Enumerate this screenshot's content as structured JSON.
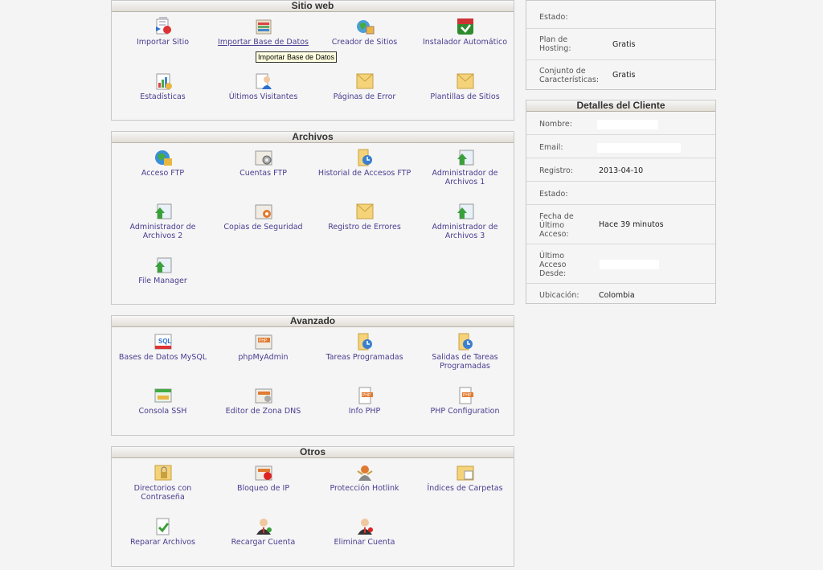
{
  "sitio_web": {
    "title": "Sitio web",
    "items": [
      {
        "label": "Importar Sitio",
        "icon": "import-site-icon"
      },
      {
        "label": "Importar Base de Datos",
        "icon": "import-database-icon"
      },
      {
        "label": "Creador de Sitios",
        "icon": "site-builder-icon"
      },
      {
        "label": "Instalador Automático",
        "icon": "auto-installer-icon"
      },
      {
        "label": "Estadísticas",
        "icon": "statistics-icon"
      },
      {
        "label": "Últimos Visitantes",
        "icon": "visitors-icon"
      },
      {
        "label": "Páginas de Error",
        "icon": "error-pages-icon"
      },
      {
        "label": "Plantillas de Sitios",
        "icon": "templates-icon"
      }
    ],
    "tooltip": "Importar Base de Datos"
  },
  "archivos": {
    "title": "Archivos",
    "items": [
      {
        "label": "Acceso FTP",
        "icon": "ftp-access-icon"
      },
      {
        "label": "Cuentas FTP",
        "icon": "ftp-accounts-icon"
      },
      {
        "label": "Historial de Accesos FTP",
        "icon": "ftp-history-icon"
      },
      {
        "label": "Administrador de Archivos 1",
        "icon": "file-manager-icon"
      },
      {
        "label": "Administrador de Archivos 2",
        "icon": "file-manager-icon"
      },
      {
        "label": "Copias de Seguridad",
        "icon": "backup-icon"
      },
      {
        "label": "Registro de Errores",
        "icon": "error-log-icon"
      },
      {
        "label": "Administrador de Archivos 3",
        "icon": "file-manager-icon"
      },
      {
        "label": "File Manager",
        "icon": "file-manager-icon"
      }
    ]
  },
  "avanzado": {
    "title": "Avanzado",
    "items": [
      {
        "label": "Bases de Datos MySQL",
        "icon": "mysql-icon"
      },
      {
        "label": "phpMyAdmin",
        "icon": "phpmyadmin-icon"
      },
      {
        "label": "Tareas Programadas",
        "icon": "scheduled-tasks-icon"
      },
      {
        "label": "Salidas de Tareas Programadas",
        "icon": "task-output-icon"
      },
      {
        "label": "Consola SSH",
        "icon": "ssh-console-icon"
      },
      {
        "label": "Editor de Zona DNS",
        "icon": "dns-editor-icon"
      },
      {
        "label": "Info PHP",
        "icon": "php-info-icon"
      },
      {
        "label": "PHP Configuration",
        "icon": "php-config-icon"
      }
    ]
  },
  "otros": {
    "title": "Otros",
    "items": [
      {
        "label": "Directorios con Contraseña",
        "icon": "password-dirs-icon"
      },
      {
        "label": "Bloqueo de IP",
        "icon": "ip-block-icon"
      },
      {
        "label": "Protección Hotlink",
        "icon": "hotlink-icon"
      },
      {
        "label": "Índices de Carpetas",
        "icon": "folder-index-icon"
      },
      {
        "label": "Reparar Archivos",
        "icon": "repair-files-icon"
      },
      {
        "label": "Recargar Cuenta",
        "icon": "reload-account-icon"
      },
      {
        "label": "Eliminar Cuenta",
        "icon": "delete-account-icon"
      }
    ]
  },
  "plan": {
    "estado_label": "Estado:",
    "estado_value": "",
    "plan_label": "Plan de Hosting:",
    "plan_value": "Gratis",
    "features_label": "Conjunto de Características:",
    "features_value": "Gratis"
  },
  "cliente": {
    "title": "Detalles del Cliente",
    "nombre_label": "Nombre:",
    "email_label": "Email:",
    "registro_label": "Registro:",
    "registro_value": "2013-04-10",
    "estado_label": "Estado:",
    "fecha_label": "Fecha de Último Acceso:",
    "fecha_value": "Hace 39 minutos",
    "desde_label": "Último Acceso Desde:",
    "ubicacion_label": "Ubicación:",
    "ubicacion_value": "Colombia"
  }
}
